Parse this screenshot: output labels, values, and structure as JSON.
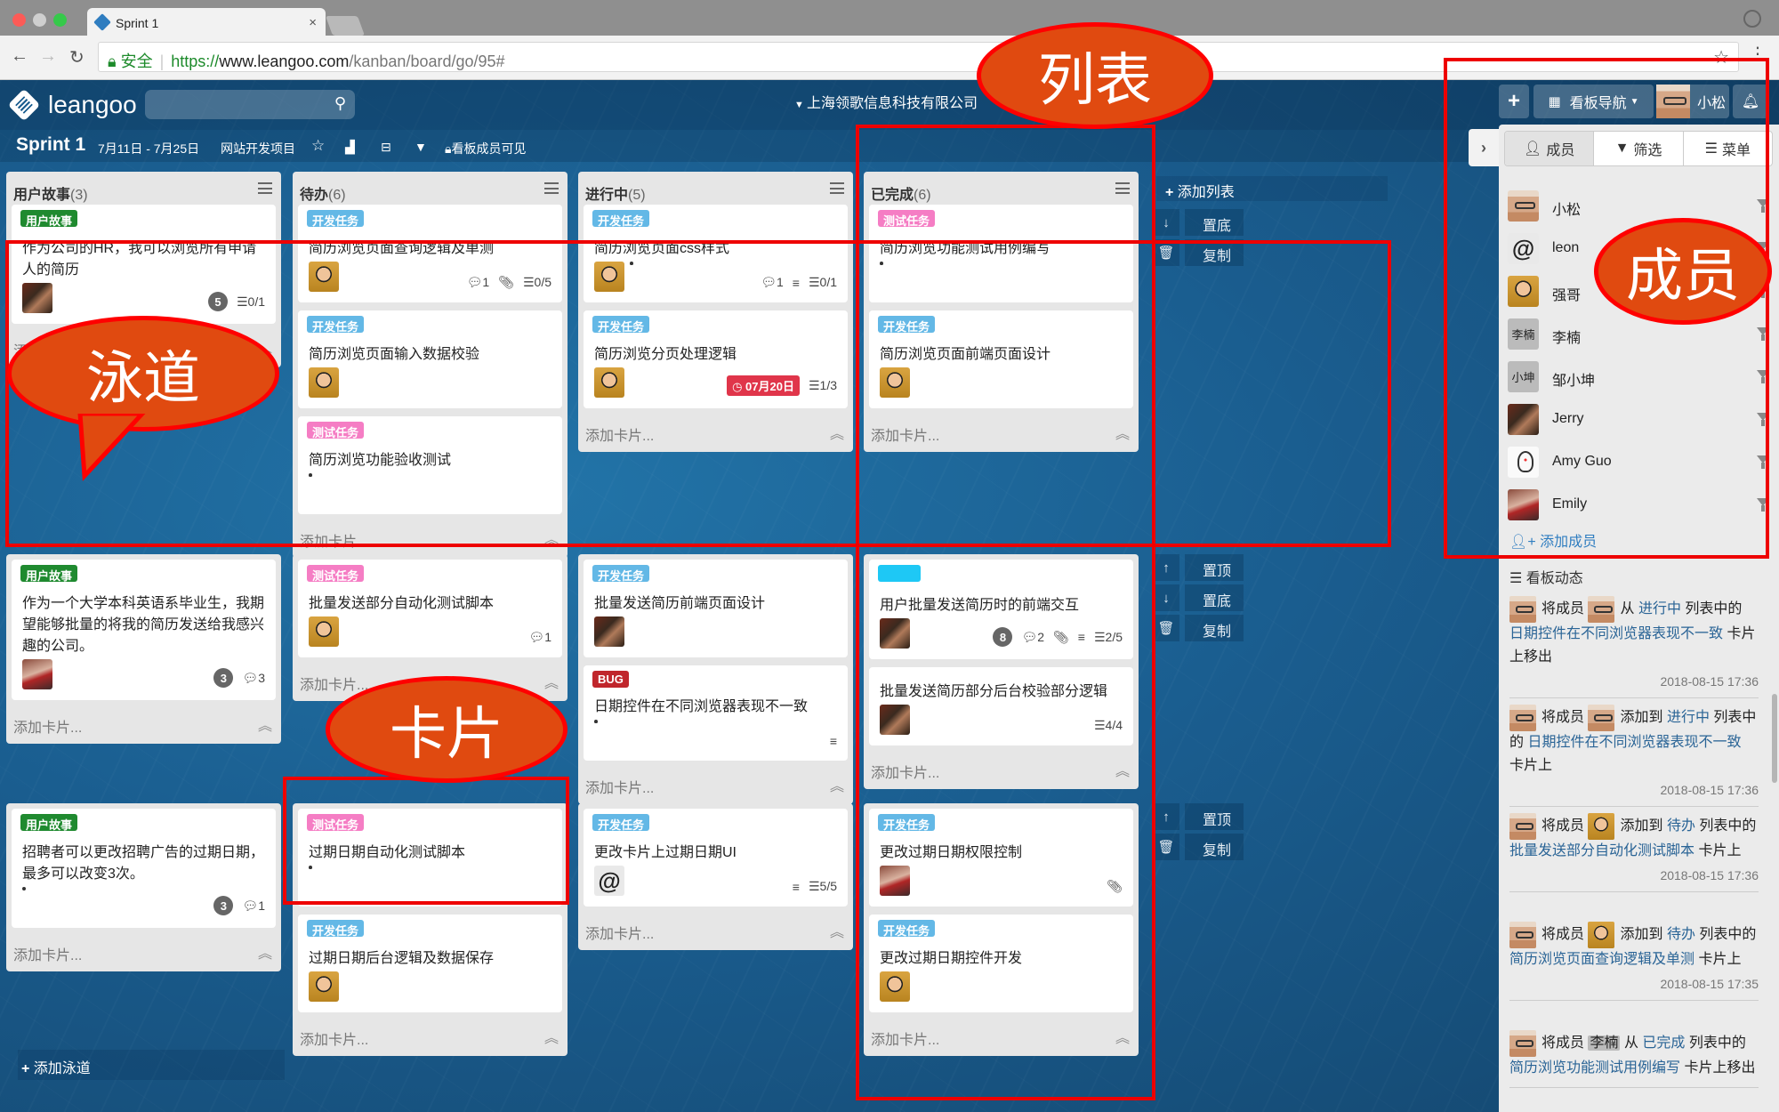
{
  "browser": {
    "tab_title": "Sprint 1",
    "url_secure_label": "安全",
    "url_scheme": "https://",
    "url_host": "www.leangoo.com",
    "url_path": "/kanban/board/go/95#"
  },
  "header": {
    "logo_text": "leangoo",
    "search_placeholder": "",
    "company": "上海领歌信息科技有限公司",
    "add_label": "+",
    "board_nav_label": "看板导航",
    "user_name": "小松"
  },
  "board": {
    "title": "Sprint 1",
    "date_range": "7月11日 - 7月25日",
    "project": "网站开发项目",
    "visibility": "看板成员可见"
  },
  "colors": {
    "label_story": "#1f8a2f",
    "label_dev": "#63b8e6",
    "label_test": "#f57dc4",
    "label_bug": "#c0262c",
    "label_cyan": "#1ec8f5",
    "due_red": "#e0354a",
    "link_blue": "#2a6496",
    "callout_fill": "#e04a10",
    "callout_border": "#ff0000"
  },
  "labels": {
    "story": "用户故事",
    "dev": "开发任务",
    "test": "测试任务",
    "bug": "BUG"
  },
  "lists": [
    {
      "name": "用户故事",
      "count": "(3)"
    },
    {
      "name": "待办",
      "count": "(6)"
    },
    {
      "name": "进行中",
      "count": "(5)"
    },
    {
      "name": "已完成",
      "count": "(6)"
    }
  ],
  "add_card_label": "添加卡片...",
  "add_list_label": "添加列表",
  "add_lane_label": "添加泳道",
  "lane_ops": {
    "top": "置顶",
    "bottom": "置底",
    "copy": "复制"
  },
  "lanes": [
    {
      "columns": [
        [
          {
            "label": "story",
            "title": "作为公司的HR，我可以浏览所有申请人的简历",
            "avatars": [
              "dark"
            ],
            "points": "5",
            "checklist": "0/1"
          }
        ],
        [
          {
            "label": "dev",
            "title": "简历浏览页面查询逻辑及单测",
            "avatars": [
              "smile"
            ],
            "comments": "1",
            "attach": true,
            "checklist": "0/5"
          },
          {
            "label": "dev",
            "title": "简历浏览页面输入数据校验",
            "avatars": [
              "smile"
            ]
          },
          {
            "label": "test",
            "title": "简历浏览功能验收测试",
            "avatars": [
              "penguin"
            ]
          }
        ],
        [
          {
            "label": "dev",
            "title": "简历浏览页面css样式",
            "avatars": [
              "smile",
              "penguin"
            ],
            "comments": "1",
            "desc": true,
            "checklist": "0/1"
          },
          {
            "label": "dev",
            "title": "简历浏览分页处理逻辑",
            "avatars": [
              "smile"
            ],
            "due": "07月20日",
            "checklist": "1/3"
          }
        ],
        [
          {
            "label": "test",
            "title": "简历浏览功能测试用例编写",
            "avatars": [
              "penguin"
            ]
          },
          {
            "label": "dev",
            "title": "简历浏览页面前端页面设计",
            "avatars": [
              "smile"
            ]
          }
        ]
      ]
    },
    {
      "columns": [
        [
          {
            "label": "story",
            "title": "作为一个大学本科英语系毕业生，我期望能够批量的将我的简历发送给我感兴趣的公司。",
            "avatars": [
              "emily"
            ],
            "points": "3",
            "comments": "3"
          }
        ],
        [
          {
            "label": "test",
            "title": "批量发送部分自动化测试脚本",
            "avatars": [
              "smile"
            ],
            "comments": "1"
          }
        ],
        [
          {
            "label": "dev",
            "title": "批量发送简历前端页面设计",
            "avatars": [
              "dark"
            ]
          },
          {
            "label": "bug",
            "title": "日期控件在不同浏览器表现不一致",
            "avatars": [
              "penguin"
            ],
            "desc": true
          }
        ],
        [
          {
            "label": "cyan",
            "title": "用户批量发送简历时的前端交互",
            "avatars": [
              "dark"
            ],
            "points": "8",
            "comments": "2",
            "attach": true,
            "desc": true,
            "checklist": "2/5"
          },
          {
            "label": "",
            "title": "批量发送简历部分后台校验部分逻辑",
            "avatars": [
              "dark"
            ],
            "checklist": "4/4"
          }
        ]
      ]
    },
    {
      "columns": [
        [
          {
            "label": "story",
            "title": "招聘者可以更改招聘广告的过期日期，最多可以改变3次。",
            "avatars": [
              "glasses"
            ],
            "points": "3",
            "comments": "1"
          }
        ],
        [
          {
            "label": "test",
            "title": "过期日期自动化测试脚本",
            "avatars": [
              "penguin"
            ]
          },
          {
            "label": "dev",
            "title": "过期日期后台逻辑及数据保存",
            "avatars": [
              "smile"
            ]
          }
        ],
        [
          {
            "label": "dev",
            "title": "更改卡片上过期日期UI",
            "avatars": [
              "at"
            ],
            "desc": true,
            "checklist": "5/5"
          }
        ],
        [
          {
            "label": "dev",
            "title": "更改过期日期权限控制",
            "avatars": [
              "emily"
            ],
            "attach": true
          },
          {
            "label": "dev",
            "title": "更改过期日期控件开发",
            "avatars": [
              "smile"
            ]
          }
        ]
      ]
    }
  ],
  "panel": {
    "tabs": [
      {
        "label": "成员",
        "icon": "user-icon",
        "active": true
      },
      {
        "label": "筛选",
        "icon": "filter-icon",
        "active": false
      },
      {
        "label": "菜单",
        "icon": "menu-icon",
        "active": false
      }
    ],
    "members": [
      {
        "name": "小松",
        "avatar": "glasses"
      },
      {
        "name": "leon",
        "avatar": "at"
      },
      {
        "name": "强哥",
        "avatar": "smile"
      },
      {
        "name": "李楠",
        "avatar": "text",
        "avatar_text": "李楠"
      },
      {
        "name": "邹小坤",
        "avatar": "text",
        "avatar_text": "小坤"
      },
      {
        "name": "Jerry",
        "avatar": "dark"
      },
      {
        "name": "Amy Guo",
        "avatar": "penguin"
      },
      {
        "name": "Emily",
        "avatar": "emily"
      }
    ],
    "add_member_label": "添加成员",
    "activity_title": "看板动态",
    "activities": [
      {
        "actor": "glasses",
        "verb": "将成员",
        "target": "glasses",
        "prep": "从",
        "list": "进行中",
        "mid": "列表中的",
        "card": "日期控件在不同浏览器表现不一致",
        "end": "卡片上移出",
        "time": "2018-08-15 17:36"
      },
      {
        "actor": "glasses",
        "verb": "将成员",
        "target": "glasses",
        "prep": "添加到",
        "list": "进行中",
        "mid": "列表中的",
        "card": "日期控件在不同浏览器表现不一致",
        "end": "卡片上",
        "time": "2018-08-15 17:36"
      },
      {
        "actor": "glasses",
        "verb": "将成员",
        "target": "smile",
        "prep": "添加到",
        "list": "待办",
        "mid": "列表中的",
        "card": "批量发送部分自动化测试脚本",
        "end": "卡片上",
        "time": "2018-08-15 17:36"
      },
      {
        "actor": "glasses",
        "verb": "将成员",
        "target": "smile",
        "prep": "添加到",
        "list": "待办",
        "mid": "列表中的",
        "card": "简历浏览页面查询逻辑及单测",
        "end": "卡片上",
        "time": "2018-08-15 17:35"
      },
      {
        "actor": "glasses",
        "verb": "将成员",
        "target_text": "李楠",
        "prep": "从",
        "list": "已完成",
        "mid": "列表中的",
        "card": "简历浏览功能测试用例编写",
        "end": "卡片上移出",
        "time": ""
      }
    ]
  },
  "callouts": {
    "lane": "泳道",
    "list": "列表",
    "card": "卡片",
    "member": "成员"
  }
}
